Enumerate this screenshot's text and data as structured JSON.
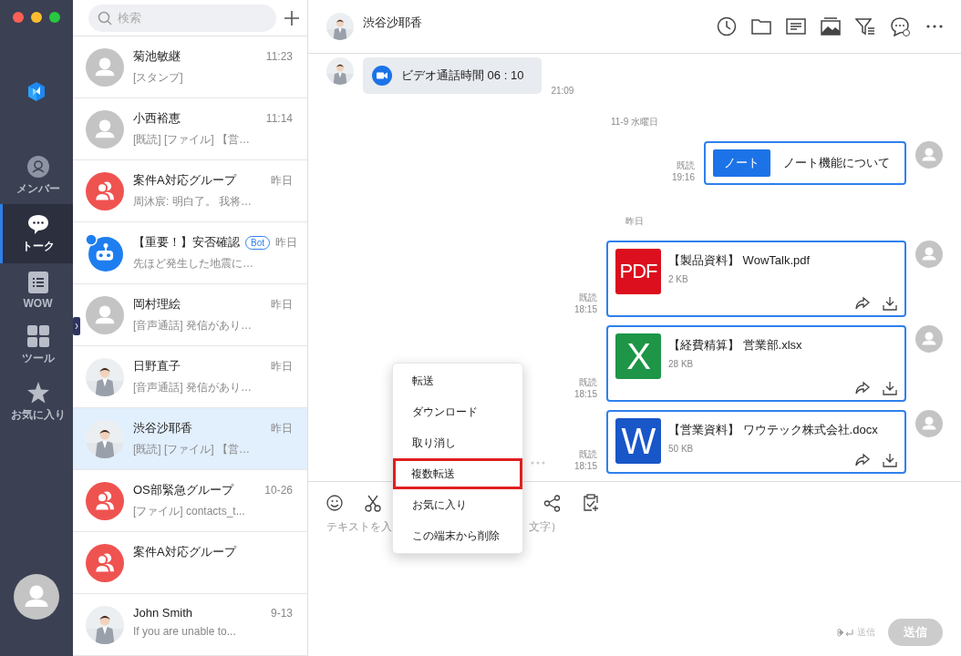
{
  "window": {
    "controls": [
      {
        "color": "#fe5f57"
      },
      {
        "color": "#febc2e"
      },
      {
        "color": "#28c840"
      }
    ]
  },
  "nav": {
    "items": [
      {
        "label": "メンバー",
        "selected": false
      },
      {
        "label": "トーク",
        "selected": true
      },
      {
        "label": "WOW",
        "selected": false
      },
      {
        "label": "ツール",
        "selected": false
      },
      {
        "label": "お気に入り",
        "selected": false
      }
    ]
  },
  "search": {
    "placeholder": "検索"
  },
  "conversations": [
    {
      "name": "菊池敏継",
      "time": "11:23",
      "preview": "[スタンプ]",
      "kind": "person",
      "selected": false
    },
    {
      "name": "小西裕恵",
      "time": "11:14",
      "preview": "[既読] [ファイル] 【営…",
      "kind": "person",
      "selected": false
    },
    {
      "name": "案件A対応グループ",
      "time": "昨日",
      "preview": "周沐宸: 明白了。 我将…",
      "kind": "group",
      "selected": false
    },
    {
      "name": "【重要！】安否確認",
      "badge": "Bot",
      "time": "昨日",
      "preview": "先ほど発生した地震に…",
      "kind": "bot",
      "selected": false
    },
    {
      "name": "岡村理絵",
      "time": "昨日",
      "preview": "[音声通話] 発信があり…",
      "kind": "person",
      "selected": false
    },
    {
      "name": "日野直子",
      "time": "昨日",
      "preview": "[音声通話] 発信があり…",
      "selected": false
    },
    {
      "name": "渋谷沙耶香",
      "time": "昨日",
      "preview": "[既読] [ファイル] 【営…",
      "selected": true
    },
    {
      "name": "OS部緊急グループ",
      "time": "10-26",
      "preview": "[ファイル] contacts_t...",
      "kind": "group",
      "selected": false
    },
    {
      "name": "案件A対応グループ",
      "kind": "group",
      "selected": false
    },
    {
      "name": "John Smith",
      "time": "9-13",
      "preview": "If you are unable to...",
      "selected": false
    }
  ],
  "chat": {
    "title": "渋谷沙耶香",
    "messages": [
      {
        "kind": "call",
        "text": "ビデオ通話時間 06 : 10",
        "time": "21:09"
      },
      {
        "kind": "date",
        "text": "11-9 水曜日"
      },
      {
        "kind": "note",
        "tag": "ノート",
        "text": "ノート機能について",
        "status": "既読",
        "time": "19:16"
      },
      {
        "kind": "date",
        "text": "昨日"
      },
      {
        "kind": "file",
        "color": "#db0f1d",
        "icon_text": "PDF",
        "name": "【製品資料】 WowTalk.pdf",
        "size": "2 KB",
        "status": "既読",
        "time": "18:15"
      },
      {
        "kind": "file",
        "color": "#1e9547",
        "icon_text": "X",
        "name": "【経費精算】 営業部.xlsx",
        "size": "28 KB",
        "status": "既読",
        "time": "18:15"
      },
      {
        "kind": "file",
        "color": "#1956c8",
        "icon_text": "W",
        "name": "【営業資料】 ワウテック株式会社.docx",
        "size": "50 KB",
        "status": "既読",
        "time": "18:15",
        "more": true
      }
    ]
  },
  "composer": {
    "placeholder_parts": [
      "テキストを入",
      "文字）"
    ],
    "shortcut": "送信",
    "send": {
      "label": "送信",
      "disabled": true
    }
  },
  "context_menu": {
    "items": [
      {
        "label": "転送",
        "selected": false
      },
      {
        "label": "ダウンロード",
        "selected": false
      },
      {
        "label": "取り消し",
        "selected": false
      },
      {
        "label": "複数転送",
        "selected": true
      },
      {
        "label": "お気に入り",
        "selected": false
      },
      {
        "label": "この端末から削除",
        "selected": false
      }
    ]
  }
}
